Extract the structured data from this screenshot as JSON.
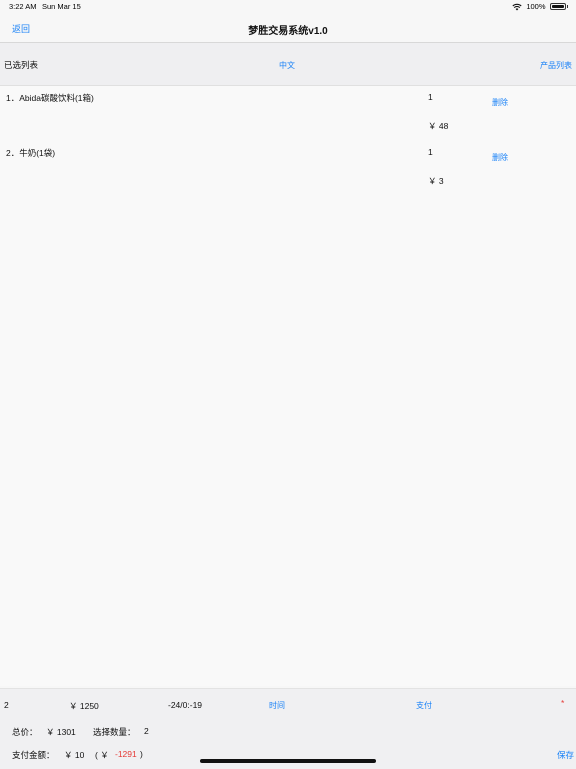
{
  "status": {
    "time": "3:22 AM",
    "date": "Sun Mar 15",
    "battery": "100%"
  },
  "nav": {
    "back": "返回",
    "title": "梦胜交易系统v1.0"
  },
  "sub": {
    "left": "已选列表",
    "mid": "中文",
    "right": "产品列表"
  },
  "items": [
    {
      "name": "1．Abida碳酸饮料(1箱)",
      "qty": "1",
      "price": "￥ 48",
      "delete": "删除"
    },
    {
      "name": "2．牛奶(1袋)",
      "qty": "1",
      "price": "￥ 3",
      "delete": "删除"
    }
  ],
  "footer": {
    "count": "2",
    "amount": "￥ 1250",
    "code": "-24/0:-19",
    "time_btn": "时间",
    "pay_btn": "支付",
    "star": "*",
    "total_label": "总价：",
    "total_value": "￥ 1301",
    "qty_label": "选择数量：",
    "qty_value": "2",
    "pay_label": "支付金额：",
    "pay_value": "￥ 10",
    "paren_open": "( ￥",
    "diff": "-1291",
    "paren_close": ")",
    "save_btn": "保存"
  }
}
